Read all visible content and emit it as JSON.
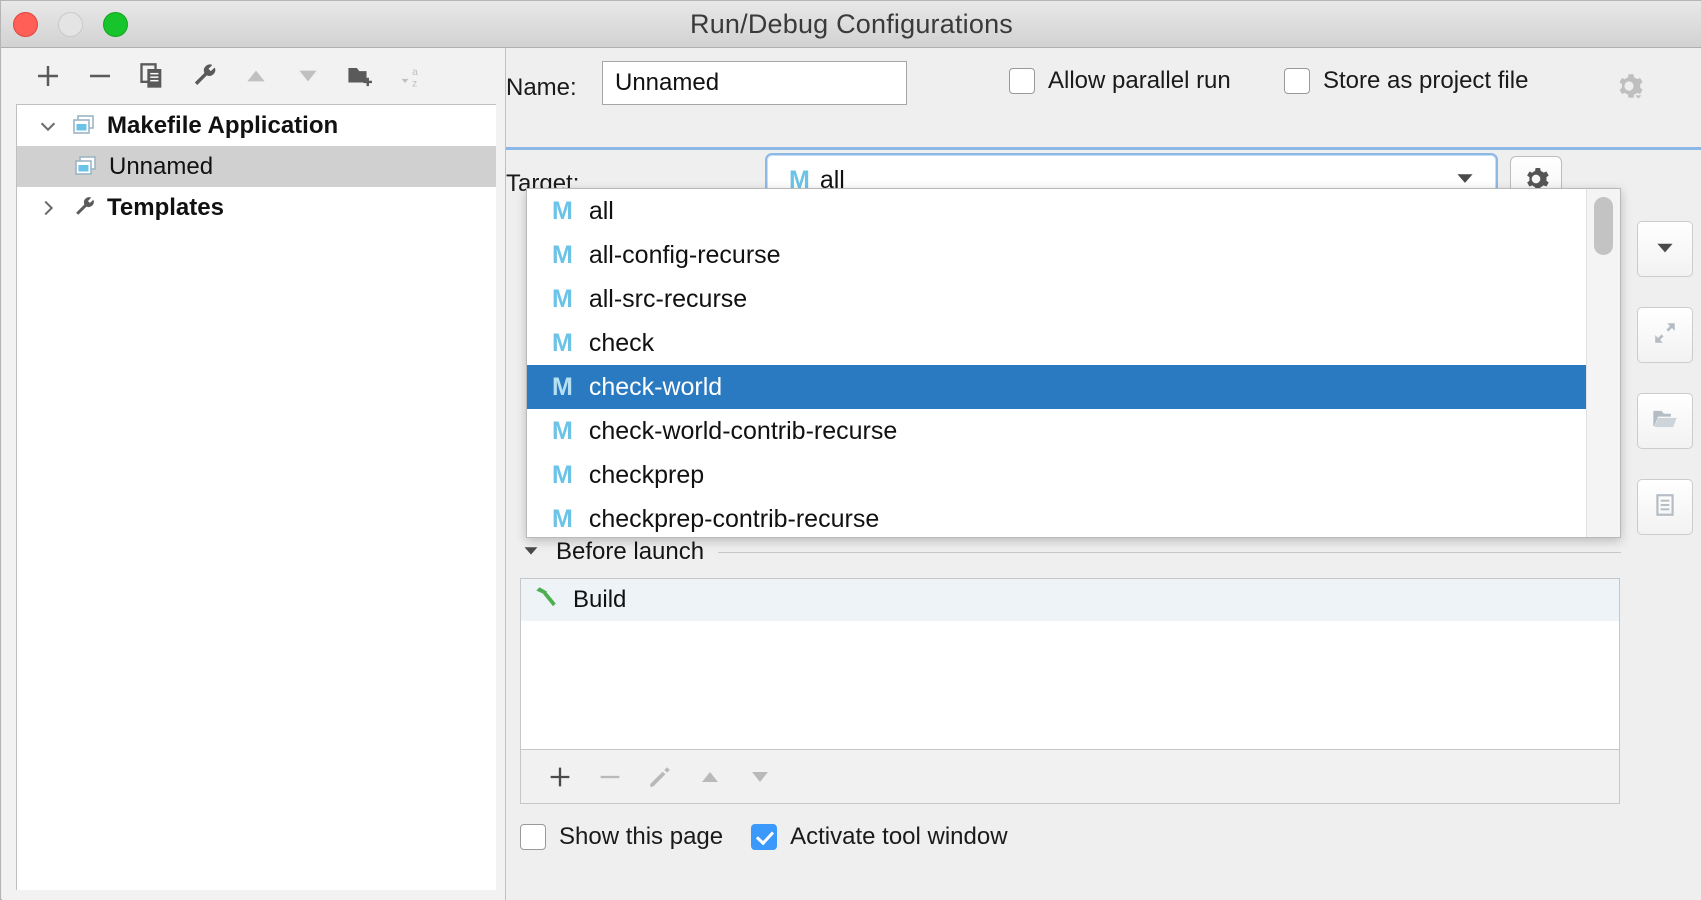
{
  "window": {
    "title": "Run/Debug Configurations",
    "traffic_lights": [
      "close-red",
      "minimize-yellow",
      "zoom-green"
    ]
  },
  "left_panel": {
    "toolbar": [
      {
        "name": "add-button",
        "icon": "plus-icon",
        "enabled": true
      },
      {
        "name": "remove-button",
        "icon": "minus-icon",
        "enabled": true
      },
      {
        "name": "copy-button",
        "icon": "copy-icon",
        "enabled": true
      },
      {
        "name": "edit-templates-button",
        "icon": "wrench-icon",
        "enabled": true
      },
      {
        "name": "move-up-button",
        "icon": "arrow-up-icon",
        "enabled": false
      },
      {
        "name": "move-down-button",
        "icon": "arrow-down-icon",
        "enabled": false
      },
      {
        "name": "new-folder-button",
        "icon": "folder-add-icon",
        "enabled": true
      },
      {
        "name": "sort-button",
        "icon": "sort-alpha-icon",
        "enabled": false
      }
    ],
    "tree": [
      {
        "label": "Makefile Application",
        "icon": "run-configuration-icon",
        "twisty": "chevron-down-icon",
        "bold": true,
        "level": 0,
        "selected": false
      },
      {
        "label": "Unnamed",
        "icon": "run-configuration-icon",
        "twisty": "",
        "bold": false,
        "level": 1,
        "selected": true
      },
      {
        "label": "Templates",
        "icon": "wrench-icon",
        "twisty": "chevron-right-icon",
        "bold": true,
        "level": 0,
        "selected": false
      }
    ]
  },
  "form": {
    "name_label": "Name:",
    "name_value": "Unnamed",
    "name_placeholder": "Unnamed",
    "allow_parallel_run": {
      "label": "Allow parallel run",
      "checked": false
    },
    "store_as_project_file": {
      "label": "Store as project file",
      "checked": false
    },
    "store_gear_icon": "gear-dropdown-icon",
    "target_label": "Target:",
    "target_value": "all",
    "target_icon": "makefile-target-icon",
    "target_gear_icon": "gear-icon"
  },
  "dropdown": {
    "open": true,
    "selected": "check-world",
    "items": [
      {
        "label": "all",
        "icon": "makefile-target-icon"
      },
      {
        "label": "all-config-recurse",
        "icon": "makefile-target-icon"
      },
      {
        "label": "all-src-recurse",
        "icon": "makefile-target-icon"
      },
      {
        "label": "check",
        "icon": "makefile-target-icon"
      },
      {
        "label": "check-world",
        "icon": "makefile-target-icon"
      },
      {
        "label": "check-world-contrib-recurse",
        "icon": "makefile-target-icon"
      },
      {
        "label": "checkprep",
        "icon": "makefile-target-icon"
      },
      {
        "label": "checkprep-contrib-recurse",
        "icon": "makefile-target-icon"
      }
    ]
  },
  "side_buttons": [
    {
      "name": "expand-dropdown-button",
      "icon": "chevron-down-icon"
    },
    {
      "name": "expand-editor-button",
      "icon": "expand-arrows-icon"
    },
    {
      "name": "browse-folder-button",
      "icon": "open-folder-icon"
    },
    {
      "name": "show-list-button",
      "icon": "document-list-icon"
    }
  ],
  "before_launch": {
    "title": "Before launch",
    "twisty": "triangle-down-icon",
    "tasks": [
      {
        "label": "Build",
        "icon": "hammer-icon"
      }
    ],
    "toolbar": [
      {
        "name": "add-task-button",
        "icon": "plus-icon",
        "enabled": true
      },
      {
        "name": "remove-task-button",
        "icon": "minus-icon",
        "enabled": false
      },
      {
        "name": "edit-task-button",
        "icon": "pencil-icon",
        "enabled": false
      },
      {
        "name": "move-task-up-button",
        "icon": "arrow-up-icon",
        "enabled": false
      },
      {
        "name": "move-task-down-button",
        "icon": "arrow-down-icon",
        "enabled": false
      }
    ]
  },
  "footer": {
    "show_this_page": {
      "label": "Show this page",
      "checked": false
    },
    "activate_tool_window": {
      "label": "Activate tool window",
      "checked": true
    }
  },
  "colors": {
    "selection_blue": "#2a7ac2",
    "focus_border": "#8cb8e8",
    "makefile_icon": "#6bc4e8",
    "checked_checkbox": "#3b99fc",
    "hammer_green": "#4caf50",
    "tree_selected_grey": "#d0d0d0"
  }
}
